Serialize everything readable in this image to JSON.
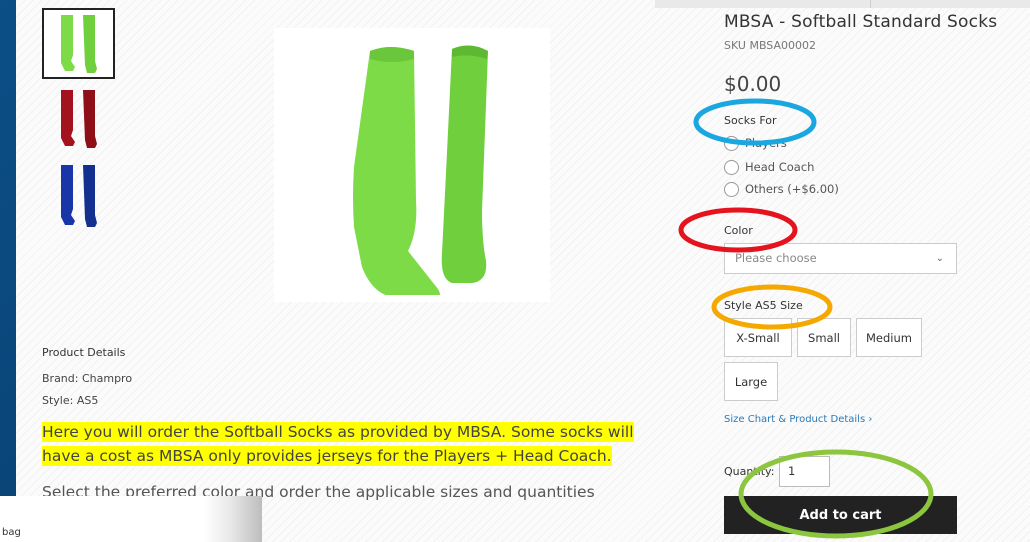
{
  "product": {
    "title": "MBSA - Softball Standard Socks",
    "sku": "SKU MBSA00002",
    "price": "$0.00"
  },
  "gallery": {
    "thumbnails": [
      {
        "name": "green-socks",
        "color": "#7cdb47"
      },
      {
        "name": "red-socks",
        "color": "#a3121d"
      },
      {
        "name": "blue-socks",
        "color": "#1836a8"
      }
    ],
    "main_color": "#7cdb47"
  },
  "options": {
    "socks_for_label": "Socks For",
    "socks_for": [
      "Players",
      "Head Coach",
      "Others (+$6.00)"
    ],
    "color_label": "Color",
    "color_placeholder": "Please choose",
    "size_label": "Style AS5 Size",
    "sizes": [
      "X-Small",
      "Small",
      "Medium",
      "Large"
    ]
  },
  "size_chart_link": "Size Chart & Product Details ›",
  "quantity": {
    "label": "Quantity:",
    "value": "1"
  },
  "add_to_cart": "Add to cart",
  "details": {
    "heading": "Product Details",
    "brand": "Brand: Champro",
    "style": "Style: AS5",
    "highlight_line1": "Here you will order the Softball Socks as provided by MBSA. Some socks will",
    "highlight_line2": "have a cost as MBSA only provides jerseys for the Players + Head Coach.",
    "select_text": "Select the preferred color and order the applicable sizes and quantities"
  },
  "popup_text": "bag",
  "colors": {
    "highlight": "#ffff00",
    "annotation_blue": "#1aa7e0",
    "annotation_red": "#e5131d",
    "annotation_orange": "#f5a800",
    "annotation_green": "#8cc63f",
    "cart_button": "#222222"
  }
}
